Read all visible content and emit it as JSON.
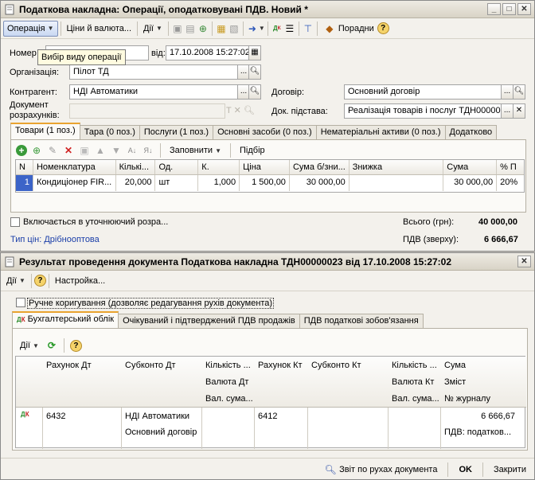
{
  "w1": {
    "title": "Податкова накладна: Операції, оподатковувані ПДВ. Новий *",
    "toolbar": {
      "operation": "Операція",
      "prices": "Ціни й валюта...",
      "actions": "Дії",
      "postings": "Порадни"
    },
    "tooltip": "Вибір виду операції",
    "fields": {
      "number_label": "Номер",
      "date_label": "від:",
      "date_value": "17.10.2008 15:27:02",
      "org_label": "Організація:",
      "org_value": "Пілот ТД",
      "contractor_label": "Контрагент:",
      "contractor_value": "НДІ Автоматики",
      "contract_label": "Договір:",
      "contract_value": "Основний договір",
      "settle_label_1": "Документ",
      "settle_label_2": "розрахунків:",
      "basis_label": "Док. підстава:",
      "basis_value": "Реалізація товарів і послуг ТДН00000"
    },
    "tabs": [
      "Товари (1 поз.)",
      "Тара (0 поз.)",
      "Послуги (1 поз.)",
      "Основні засоби (0 поз.)",
      "Нематеріальні активи (0 поз.)",
      "Додатково"
    ],
    "table_toolbar": {
      "fill": "Заповнити",
      "pick": "Підбір"
    },
    "columns": [
      "N",
      "Номенклатура",
      "Кількі...",
      "Од.",
      "К.",
      "Ціна",
      "Сума б/зни...",
      "Знижка",
      "Сума",
      "% П"
    ],
    "rows": [
      [
        "1",
        "Кондиціонер FIR...",
        "20,000",
        "шт",
        "1,000",
        "1 500,00",
        "30 000,00",
        "",
        "30 000,00",
        "20%"
      ]
    ],
    "include_label": "Включається в уточнюючий розра...",
    "price_type": "Тип цін: Дрібнооптова",
    "total_label": "Всього (грн):",
    "total_value": "40 000,00",
    "vat_label": "ПДВ (зверху):",
    "vat_value": "6 666,67"
  },
  "w2": {
    "title": "Результат проведення документа Податкова накладна ТДН00000023 від 17.10.2008 15:27:02",
    "toolbar": {
      "actions": "Дії",
      "settings": "Настройка..."
    },
    "manual_label": "Ручне коригування (дозволяє редагування рухів документа)",
    "tabs": [
      "Бухгалтерський облік",
      "Очікуваний і підтверджений ПДВ продажів",
      "ПДВ податкові зобов'язання"
    ],
    "sub_actions": "Дії",
    "headers": {
      "r1": [
        "Рахунок Дт",
        "Субконто Дт",
        "Кількість ...",
        "Рахунок Кт",
        "Субконто Кт",
        "Кількість ...",
        "Сума"
      ],
      "r2": [
        "Валюта Дт",
        "Валюта Кт",
        "Зміст"
      ],
      "r3": [
        "Вал. сума...",
        "Вал. сума...",
        "№ журналу"
      ]
    },
    "row": {
      "acc_dt": "6432",
      "sub_dt_1": "НДІ Автоматики",
      "sub_dt_2": "Основний договір",
      "acc_kt": "6412",
      "sum": "6 666,67",
      "content": "ПДВ: податков..."
    },
    "footer": {
      "report": "Звіт по рухах документа",
      "ok": "OK",
      "close": "Закрити"
    }
  }
}
